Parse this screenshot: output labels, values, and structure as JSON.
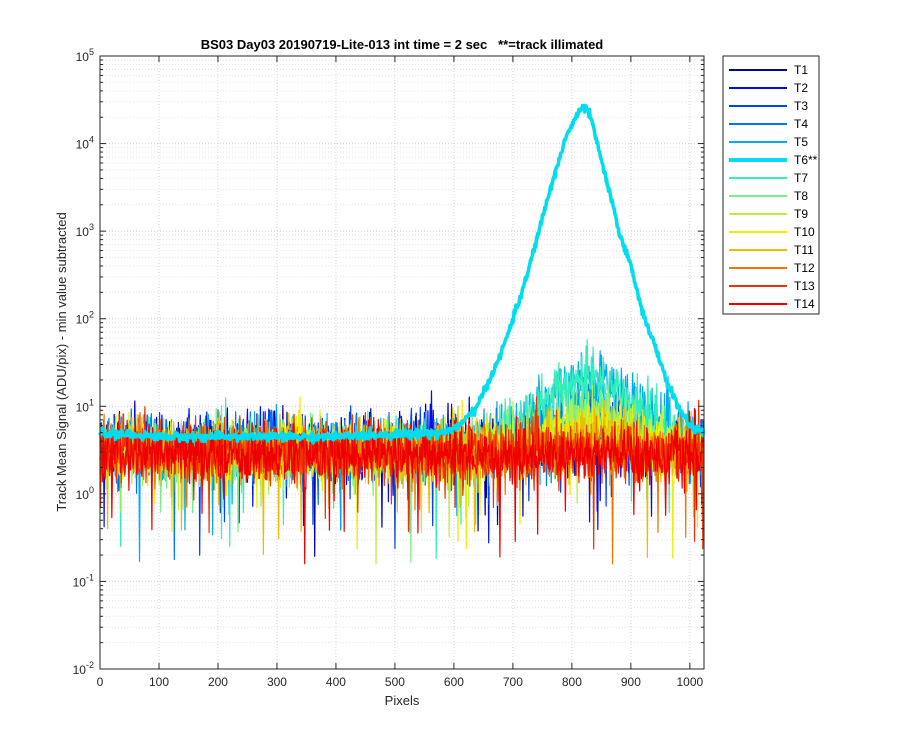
{
  "chart_data": {
    "type": "line",
    "title": "BS03 Day03 20190719-Lite-013 int time = 2 sec   **=track illimated",
    "xlabel": "Pixels",
    "ylabel": "Track Mean Signal (ADU/pix) - min value subtracted",
    "xlim": [
      0,
      1024
    ],
    "ylim": [
      0.01,
      100000
    ],
    "yscale": "log",
    "grid": true,
    "legend_position": "outside-right-top",
    "x_ticks": [
      "0",
      "100",
      "200",
      "300",
      "400",
      "500",
      "600",
      "700",
      "800",
      "900",
      "1000"
    ],
    "y_ticks": [
      {
        "base": "10",
        "exp": "-2"
      },
      {
        "base": "10",
        "exp": "-1"
      },
      {
        "base": "10",
        "exp": "0"
      },
      {
        "base": "10",
        "exp": "1"
      },
      {
        "base": "10",
        "exp": "2"
      },
      {
        "base": "10",
        "exp": "3"
      },
      {
        "base": "10",
        "exp": "4"
      },
      {
        "base": "10",
        "exp": "5"
      }
    ],
    "series": [
      {
        "name": "T1",
        "color": "#0000aa",
        "baseline": 3.5,
        "peak_x": 840,
        "peak": 0,
        "spread": 0
      },
      {
        "name": "T2",
        "color": "#0010dd",
        "baseline": 3.5,
        "peak_x": 840,
        "peak": 5,
        "spread": 0.5
      },
      {
        "name": "T3",
        "color": "#0044ee",
        "baseline": 3.5,
        "peak_x": 840,
        "peak": 6,
        "spread": 0.5
      },
      {
        "name": "T4",
        "color": "#0077ee",
        "baseline": 3.2,
        "peak_x": 830,
        "peak": 8,
        "spread": 0.7
      },
      {
        "name": "T5",
        "color": "#00aaee",
        "baseline": 3.2,
        "peak_x": 830,
        "peak": 20,
        "spread": 0.7
      },
      {
        "name": "T6**",
        "color": "#00ddee",
        "baseline": 4.5,
        "peak_x": 825,
        "peak": 25000,
        "spread": 0.08,
        "highlight": true
      },
      {
        "name": "T7",
        "color": "#33eebb",
        "baseline": 3.2,
        "peak_x": 830,
        "peak": 20,
        "spread": 0.6
      },
      {
        "name": "T8",
        "color": "#77ee88",
        "baseline": 3.0,
        "peak_x": 830,
        "peak": 8,
        "spread": 0.6
      },
      {
        "name": "T9",
        "color": "#bbee44",
        "baseline": 3.0,
        "peak_x": 840,
        "peak": 7,
        "spread": 0.6
      },
      {
        "name": "T10",
        "color": "#eeee00",
        "baseline": 3.0,
        "peak_x": 840,
        "peak": 5,
        "spread": 0.6
      },
      {
        "name": "T11",
        "color": "#eebb00",
        "baseline": 3.0,
        "peak_x": 840,
        "peak": 4,
        "spread": 0.5
      },
      {
        "name": "T12",
        "color": "#ee7700",
        "baseline": 3.0,
        "peak_x": 840,
        "peak": 0,
        "spread": 0
      },
      {
        "name": "T13",
        "color": "#ee3300",
        "baseline": 3.0,
        "peak_x": 840,
        "peak": 0,
        "spread": 0
      },
      {
        "name": "T14",
        "color": "#ee0000",
        "baseline": 2.8,
        "peak_x": 840,
        "peak": 0,
        "spread": 0
      }
    ],
    "t6_profile": {
      "x": [
        0,
        100,
        200,
        300,
        400,
        500,
        580,
        610,
        640,
        680,
        720,
        760,
        790,
        810,
        820,
        825,
        830,
        840,
        860,
        880,
        900,
        920,
        940,
        960,
        980,
        1000,
        1024
      ],
      "y": [
        5,
        4.5,
        4.5,
        4.5,
        4.5,
        4.8,
        5,
        6,
        10,
        40,
        250,
        2500,
        12000,
        22000,
        26000,
        25000,
        22000,
        12000,
        3500,
        1000,
        400,
        120,
        50,
        20,
        10,
        6,
        5
      ]
    }
  }
}
